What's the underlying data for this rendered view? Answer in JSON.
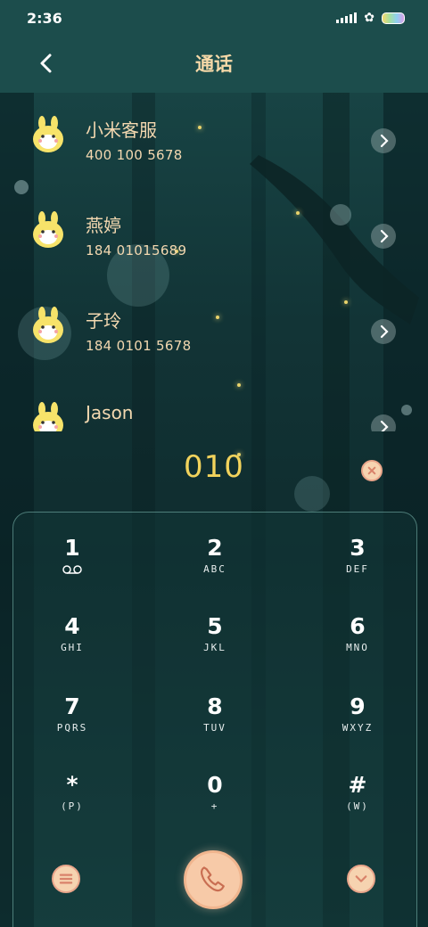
{
  "status_bar": {
    "time": "2:36",
    "icons": [
      "signal-icon",
      "clover-icon",
      "battery-icon"
    ]
  },
  "header": {
    "title": "通话",
    "back_icon": "chevron-left-icon"
  },
  "contacts": [
    {
      "name": "小米客服",
      "number": "400 100 5678",
      "avatar": "bunny-avatar"
    },
    {
      "name": "燕婷",
      "number": "184 01015689",
      "avatar": "bunny-avatar"
    },
    {
      "name": "子玲",
      "number": "184 0101 5678",
      "avatar": "bunny-avatar"
    },
    {
      "name": "Jason",
      "number": "",
      "avatar": "bunny-avatar"
    }
  ],
  "dialer": {
    "input": "010",
    "clear_icon": "clear-icon"
  },
  "keypad": {
    "keys": [
      {
        "digit": "1",
        "letters": ""
      },
      {
        "digit": "2",
        "letters": "ABC"
      },
      {
        "digit": "3",
        "letters": "DEF"
      },
      {
        "digit": "4",
        "letters": "GHI"
      },
      {
        "digit": "5",
        "letters": "JKL"
      },
      {
        "digit": "6",
        "letters": "MNO"
      },
      {
        "digit": "7",
        "letters": "PQRS"
      },
      {
        "digit": "8",
        "letters": "TUV"
      },
      {
        "digit": "9",
        "letters": "WXYZ"
      },
      {
        "digit": "*",
        "letters": "(P)"
      },
      {
        "digit": "0",
        "letters": "+"
      },
      {
        "digit": "#",
        "letters": "(W)"
      }
    ]
  },
  "bottom_bar": {
    "menu_icon": "menu-icon",
    "call_icon": "phone-icon",
    "more_icon": "chevron-down-icon"
  },
  "colors": {
    "accent": "#f2d35c",
    "name_text": "#f3d8b0",
    "title_text": "#f6d9a8",
    "button_fill": "#f6d3b0",
    "background": "#123436"
  }
}
